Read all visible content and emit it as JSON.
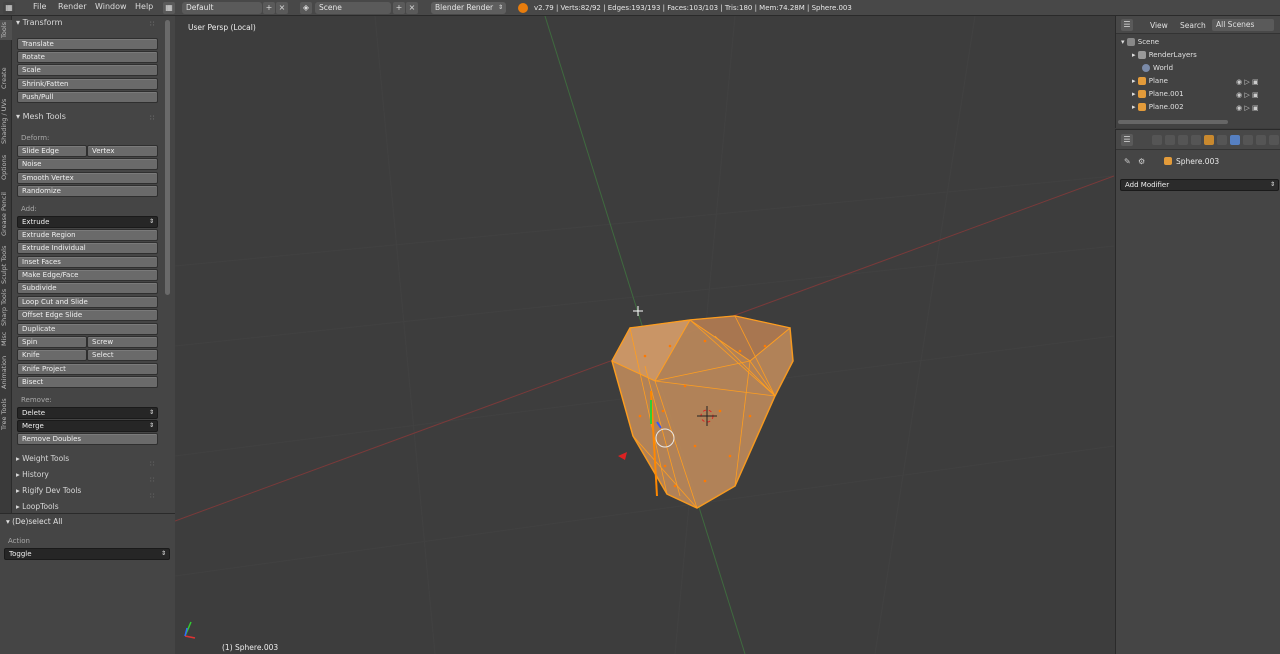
{
  "topbar": {
    "menus": [
      "File",
      "Render",
      "Window",
      "Help"
    ],
    "layout_name": "Default",
    "scene_name": "Scene",
    "render_engine": "Blender Render",
    "stats": "v2.79 | Verts:82/92 | Edges:193/193 | Faces:103/103 | Tris:180 | Mem:74.28M | Sphere.003"
  },
  "lefttabs": [
    "Tools",
    "Create",
    "Shading / UVs",
    "Options",
    "Grease Pencil",
    "Sculpt Tools",
    "Sharp Tools",
    "Misc",
    "Animation",
    "Tree Tools"
  ],
  "shelf": {
    "transform_title": "Transform",
    "transform_buttons": [
      "Translate",
      "Rotate",
      "Scale",
      "Shrink/Fatten",
      "Push/Pull"
    ],
    "mesh_tools_title": "Mesh Tools",
    "deform_label": "Deform:",
    "slide_edge": "Slide Edge",
    "vertex": "Vertex",
    "noise": "Noise",
    "smooth_vertex": "Smooth Vertex",
    "randomize": "Randomize",
    "add_label": "Add:",
    "extrude": "Extrude",
    "add_buttons": [
      "Extrude Region",
      "Extrude Individual",
      "Inset Faces",
      "Make Edge/Face",
      "Subdivide",
      "Loop Cut and Slide",
      "Offset Edge Slide",
      "Duplicate"
    ],
    "spin": "Spin",
    "screw": "Screw",
    "knife": "Knife",
    "select": "Select",
    "knife_project": "Knife Project",
    "bisect": "Bisect",
    "remove_label": "Remove:",
    "delete": "Delete",
    "merge": "Merge",
    "remove_doubles": "Remove Doubles",
    "collapsed_panels": [
      "Weight Tools",
      "History",
      "Rigify Dev Tools",
      "LoopTools"
    ]
  },
  "operator": {
    "title": "(De)select All",
    "action_label": "Action",
    "action_value": "Toggle"
  },
  "viewport": {
    "view_name": "User Persp (Local)",
    "object_label": "(1) Sphere.003"
  },
  "outliner": {
    "view": "View",
    "search": "Search",
    "all_scenes": "All Scenes",
    "items": [
      "Scene",
      "RenderLayers",
      "World",
      "Plane",
      "Plane.001",
      "Plane.002"
    ]
  },
  "properties": {
    "object_name": "Sphere.003",
    "add_modifier": "Add Modifier"
  },
  "colors": {
    "mesh_orange": "#ff9e1f",
    "mesh_fill": "#b8865a",
    "x_axis": "#c23a3a",
    "y_axis": "#4f8a4f"
  }
}
